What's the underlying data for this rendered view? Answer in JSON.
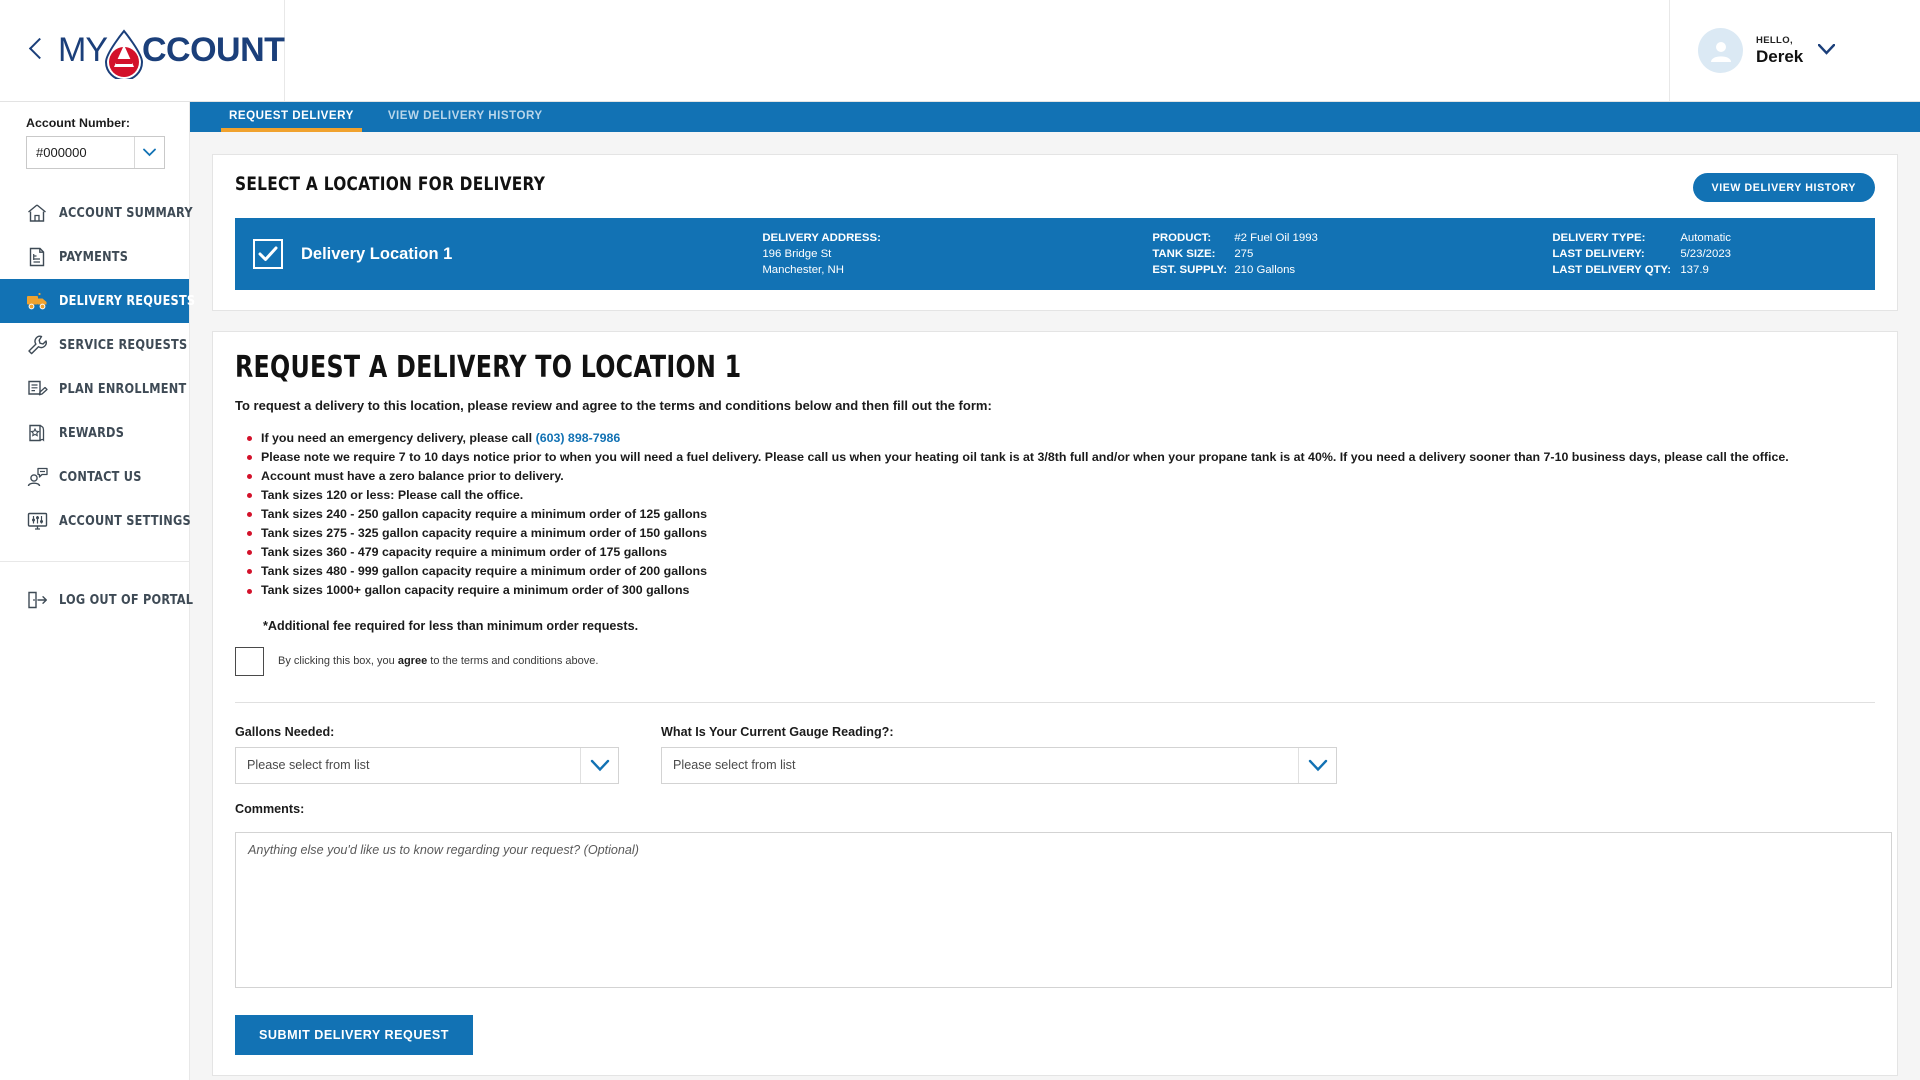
{
  "brand": {
    "name_part1": "MY",
    "name_part2": "CCOUNT",
    "back_icon": "chevron-left-icon",
    "droplet_icon": "oil-droplet-icon"
  },
  "user": {
    "greeting": "HELLO,",
    "name": "Derek",
    "avatar_icon": "user-avatar-icon",
    "caret_icon": "chevron-down-icon"
  },
  "sidebar": {
    "account_label": "Account Number:",
    "account_value": "#000000",
    "account_caret_icon": "chevron-down-icon",
    "items": [
      {
        "label": "Account Summary",
        "icon": "home-icon",
        "active": false
      },
      {
        "label": "Payments",
        "icon": "invoice-icon",
        "active": false
      },
      {
        "label": "Delivery Requests",
        "icon": "delivery-truck-icon",
        "active": true
      },
      {
        "label": "Service Requests",
        "icon": "wrench-icon",
        "active": false
      },
      {
        "label": "Plan Enrollment",
        "icon": "document-pencil-icon",
        "active": false
      },
      {
        "label": "Rewards",
        "icon": "rewards-card-icon",
        "active": false
      },
      {
        "label": "Contact Us",
        "icon": "person-chat-icon",
        "active": false
      },
      {
        "label": "Account Settings",
        "icon": "settings-monitor-icon",
        "active": false
      }
    ],
    "logout": {
      "label": "Log Out Of Portal",
      "icon": "logout-door-icon"
    }
  },
  "tabs": [
    {
      "label": "Request Delivery",
      "active": true
    },
    {
      "label": "View Delivery History",
      "active": false
    }
  ],
  "location_panel": {
    "title": "Select a Location for Delivery",
    "history_button": "View Delivery History",
    "card": {
      "checked": true,
      "check_icon": "checkmark-icon",
      "name": "Delivery Location 1",
      "address_label": "DELIVERY ADDRESS:",
      "address_line1": "196 Bridge St",
      "address_line2": "Manchester, NH",
      "product_label": "PRODUCT:",
      "product_value": "#2 Fuel Oil 1993",
      "tank_size_label": "TANK SIZE:",
      "tank_size_value": "275",
      "est_supply_label": "EST. SUPPLY:",
      "est_supply_value": "210 Gallons",
      "delivery_type_label": "DELIVERY TYPE:",
      "delivery_type_value": "Automatic",
      "last_delivery_label": "LAST DELIVERY:",
      "last_delivery_value": "5/23/2023",
      "last_qty_label": "LAST DELIVERY QTY:",
      "last_qty_value": "137.9"
    }
  },
  "request_panel": {
    "title": "Request a Delivery to Location 1",
    "intro": "To request a delivery to this location, please review and agree to the terms and conditions below and then fill out the form:",
    "terms": [
      {
        "text_before": "If you need an emergency delivery, please call ",
        "link": "(603) 898-7986",
        "text_after": ""
      },
      {
        "text_before": "Please note we require 7 to 10 days notice prior to when you will need a fuel delivery. Please call us when your heating oil tank is at 3/8th full and/or when your propane tank is at 40%. If you need a delivery sooner than 7-10 business days, please call the office.",
        "link": "",
        "text_after": ""
      },
      {
        "text_before": "Account must have a zero balance prior to delivery.",
        "link": "",
        "text_after": ""
      },
      {
        "text_before": "Tank sizes 120 or less: Please call the office.",
        "link": "",
        "text_after": ""
      },
      {
        "text_before": "Tank sizes 240 - 250 gallon capacity require a minimum order of 125 gallons",
        "link": "",
        "text_after": ""
      },
      {
        "text_before": "Tank sizes 275 - 325 gallon capacity require a minimum order of 150 gallons",
        "link": "",
        "text_after": ""
      },
      {
        "text_before": "Tank sizes 360 - 479 capacity require a minimum order of 175 gallons",
        "link": "",
        "text_after": ""
      },
      {
        "text_before": "Tank sizes 480 - 999 gallon capacity require a minimum order of 200 gallons",
        "link": "",
        "text_after": ""
      },
      {
        "text_before": "Tank sizes 1000+ gallon capacity require a minimum order of 300 gallons",
        "link": "",
        "text_after": ""
      }
    ],
    "footnote": "*Additional fee required for less than minimum order requests.",
    "agree": {
      "checked": false,
      "text_before": "By clicking this box, you ",
      "emphasis": "agree",
      "text_after": " to the terms and conditions above."
    },
    "gallons_field": {
      "label": "Gallons Needed:",
      "value": "Please select from list",
      "caret_icon": "chevron-down-icon"
    },
    "gauge_field": {
      "label": "What Is Your Current Gauge Reading?:",
      "value": "Please select from list",
      "caret_icon": "chevron-down-icon"
    },
    "comments": {
      "label": "Comments:",
      "placeholder": "Anything else you'd like us to know regarding your request? (Optional)",
      "value": ""
    },
    "submit_button": "Submit Delivery Request"
  },
  "colors": {
    "brand_blue": "#1272b4",
    "brand_navy": "#1b3f7a",
    "brand_red": "#d3112a",
    "accent_orange": "#f0a22e",
    "sidebar_text": "#3e4a55"
  }
}
